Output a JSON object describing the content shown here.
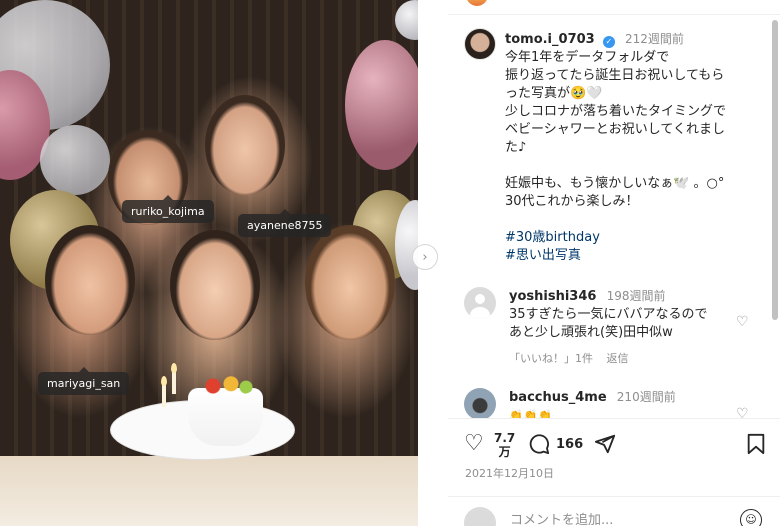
{
  "photo": {
    "tags": [
      "ruriko_kojima",
      "ayanene8755",
      "mariyagi_san"
    ],
    "next_icon": "chevron-right-icon"
  },
  "post": {
    "username": "tomo.i_0703",
    "verified_icon": "verified-badge-icon",
    "time": "212週間前",
    "caption_lines": [
      "今年1年をデータフォルダで",
      "振り返ってたら誕生日お祝いしてもら",
      "った写真が🥹🤍",
      "少しコロナが落ち着いたタイミングで",
      "ベビーシャワーとお祝いしてくれまし",
      "た♪",
      "",
      "妊娠中も、もう懐かしいなぁ🕊️ 。○°",
      "30代これから楽しみ！"
    ],
    "hashtags": [
      "#30歳birthday",
      "#思い出写真"
    ]
  },
  "comments": [
    {
      "username": "yoshishi346",
      "time": "198週間前",
      "text_lines": [
        "35すぎたら一気にババアなるので",
        "あと少し頑張れ(笑)田中似w"
      ],
      "likes": "「いいね！」1件",
      "reply": "返信"
    },
    {
      "username": "bacchus_4me",
      "time": "210週間前",
      "text_lines": [
        "👏👏👏"
      ]
    }
  ],
  "actions": {
    "like_icon": "heart-outline-icon",
    "like_count_line1": "7.7",
    "like_count_line2": "万",
    "comment_icon": "comment-bubble-icon",
    "comment_count": "166",
    "share_icon": "paper-plane-icon",
    "save_icon": "bookmark-icon",
    "date": "2021年12月10日"
  },
  "composer": {
    "placeholder": "コメントを追加...",
    "emoji_icon": "smiley-icon"
  }
}
